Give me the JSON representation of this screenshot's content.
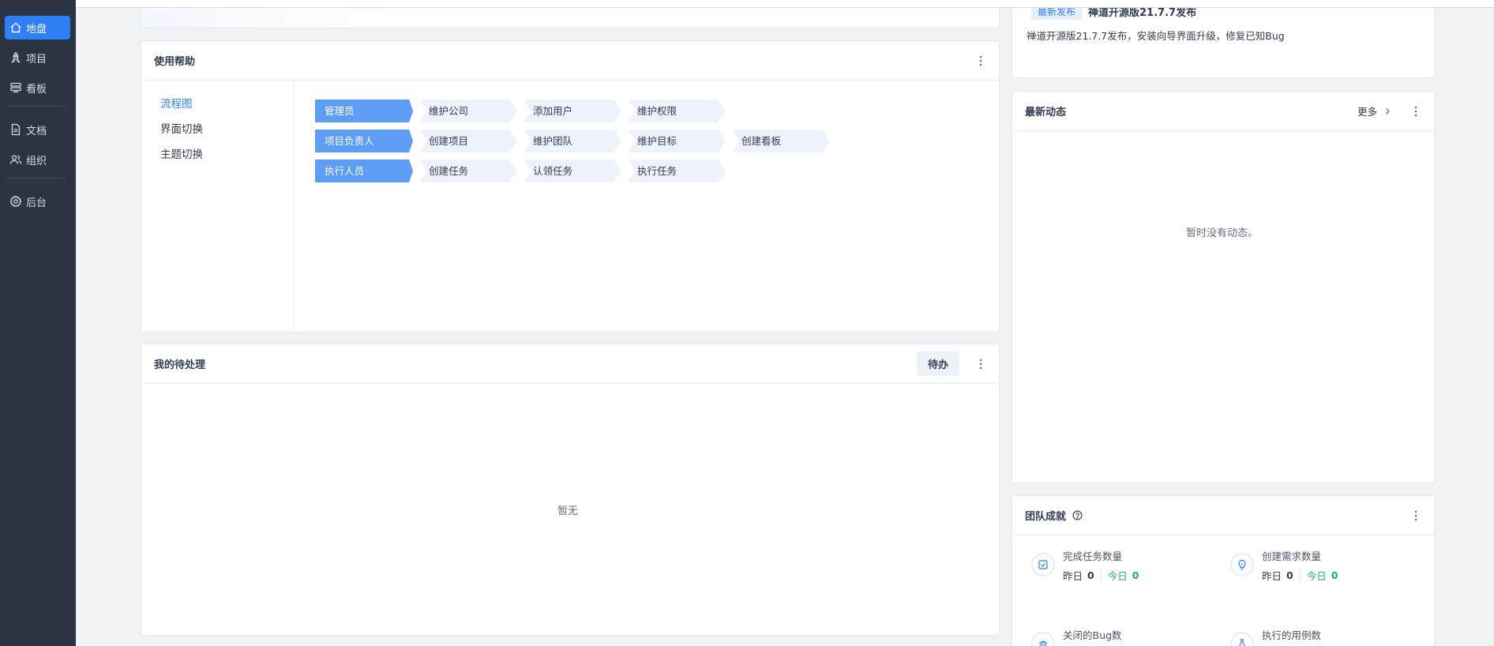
{
  "sidebar": {
    "items": [
      {
        "label": "地盘",
        "icon": "home-icon",
        "active": true
      },
      {
        "label": "项目",
        "icon": "rocket-icon"
      },
      {
        "label": "看板",
        "icon": "kanban-icon"
      },
      {
        "label": "文档",
        "icon": "document-icon"
      },
      {
        "label": "组织",
        "icon": "users-icon"
      },
      {
        "label": "后台",
        "icon": "gear-icon"
      }
    ]
  },
  "help": {
    "title": "使用帮助",
    "tabs": [
      "流程图",
      "界面切换",
      "主题切换"
    ],
    "flow": [
      {
        "role": "管理员",
        "steps": [
          "维护公司",
          "添加用户",
          "维护权限"
        ]
      },
      {
        "role": "项目负责人",
        "steps": [
          "创建项目",
          "维护团队",
          "维护目标",
          "创建看板"
        ]
      },
      {
        "role": "执行人员",
        "steps": [
          "创建任务",
          "认领任务",
          "执行任务"
        ]
      }
    ]
  },
  "todo": {
    "title": "我的待处理",
    "button": "待办",
    "empty": "暂无"
  },
  "release": {
    "badge": "最新发布",
    "headline": "禅道开源版21.7.7发布",
    "desc": "禅道开源版21.7.7发布，安装向导界面升级，修复已知Bug"
  },
  "activity": {
    "title": "最新动态",
    "more": "更多",
    "empty": "暂时没有动态。"
  },
  "team": {
    "title": "团队成就",
    "stats": [
      {
        "title": "完成任务数量",
        "yesterday_label": "昨日",
        "yesterday": "0",
        "today_label": "今日",
        "today": "0",
        "icon": "checkbox-icon"
      },
      {
        "title": "创建需求数量",
        "yesterday_label": "昨日",
        "yesterday": "0",
        "today_label": "今日",
        "today": "0",
        "icon": "lightbulb-icon"
      },
      {
        "title": "关闭的Bug数",
        "icon": "bug-icon"
      },
      {
        "title": "执行的用例数",
        "icon": "testcase-icon"
      }
    ]
  },
  "colors": {
    "accent": "#2e7ff3",
    "sidebar_bg": "#2b3441",
    "today_green": "#1cb06c"
  }
}
